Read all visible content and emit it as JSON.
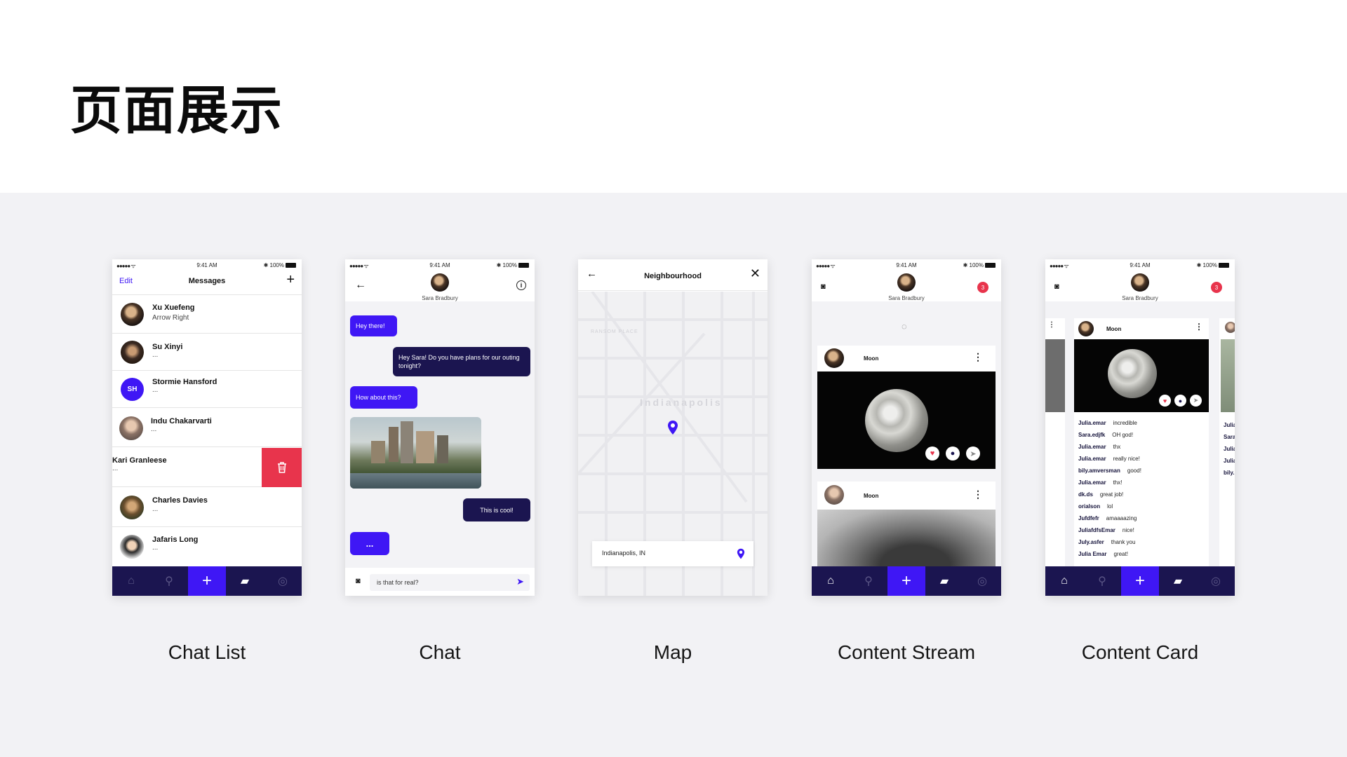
{
  "title": "页面展示",
  "captions": [
    "Chat List",
    "Chat",
    "Map",
    "Content Stream",
    "Content Card"
  ],
  "status": {
    "signal": "●●●●● ᯤ",
    "time": "9:41 AM",
    "battery": "✱ 100%"
  },
  "chat_list": {
    "edit": "Edit",
    "title": "Messages",
    "add": "+",
    "items": [
      {
        "name": "Xu Xuefeng",
        "preview": "Arrow Right"
      },
      {
        "name": "Su Xinyi",
        "preview": "..."
      },
      {
        "name": "Stormie Hansford",
        "preview": "...",
        "initials": "SH"
      },
      {
        "name": "Indu Chakarvarti",
        "preview": "..."
      },
      {
        "name": "Kari Granleese",
        "preview": "..."
      },
      {
        "name": "Charles Davies",
        "preview": "..."
      },
      {
        "name": "Jafaris Long",
        "preview": "..."
      }
    ]
  },
  "chat": {
    "contact": "Sara Bradbury",
    "messages": [
      "Hey there!",
      "Hey Sara!  Do you have plans for our outing tonight?",
      "How about this?",
      "This is cool!",
      "..."
    ],
    "input_value": "is that for real?"
  },
  "map": {
    "title": "Neighbourhood",
    "city_label": "Indianapolis",
    "place_label": "RANSOM PLACE",
    "search_value": "Indianapolis, IN"
  },
  "stream": {
    "user": "Sara Bradbury",
    "badge": "3",
    "posts": [
      {
        "title": "Moon"
      },
      {
        "title": "Moon"
      }
    ]
  },
  "card": {
    "user": "Sara Bradbury",
    "badge": "3",
    "post_title": "Moon",
    "comments": [
      {
        "user": "Julia.emar",
        "text": "incredible"
      },
      {
        "user": "Sara.edjfk",
        "text": "OH god!"
      },
      {
        "user": "Julia.emar",
        "text": "thx"
      },
      {
        "user": "Julia.emar",
        "text": "really nice!"
      },
      {
        "user": "bily.amversman",
        "text": "good!"
      },
      {
        "user": "Julia.emar",
        "text": "thx!"
      },
      {
        "user": "dk.ds",
        "text": "great job!"
      },
      {
        "user": "orialson",
        "text": "lol"
      },
      {
        "user": "Jufdfefr",
        "text": "amaaaazing"
      },
      {
        "user": "JuliafdfsEmar",
        "text": "nice!"
      },
      {
        "user": "July.asfer",
        "text": "thank you"
      },
      {
        "user": "Julia Emar",
        "text": "great!"
      }
    ],
    "peek_right": [
      "Julia",
      "Sara",
      "Julia",
      "Julia",
      "bily."
    ]
  },
  "colors": {
    "accent": "#3f17f5",
    "navy": "#1b1550",
    "danger": "#e8344c",
    "stage": "#f2f2f5"
  }
}
